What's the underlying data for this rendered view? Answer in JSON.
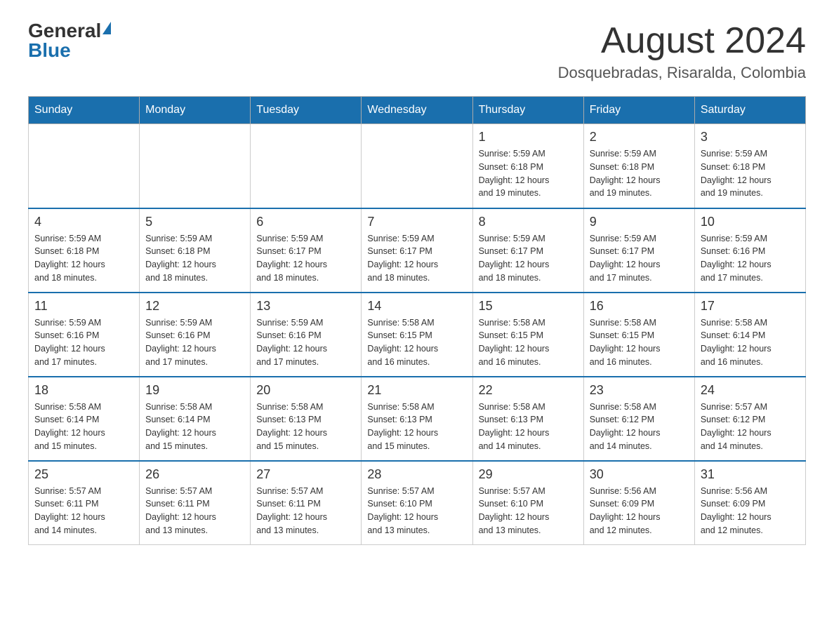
{
  "header": {
    "logo_general": "General",
    "logo_blue": "Blue",
    "month_title": "August 2024",
    "location": "Dosquebradas, Risaralda, Colombia"
  },
  "days_of_week": [
    "Sunday",
    "Monday",
    "Tuesday",
    "Wednesday",
    "Thursday",
    "Friday",
    "Saturday"
  ],
  "weeks": [
    {
      "days": [
        {
          "number": "",
          "info": ""
        },
        {
          "number": "",
          "info": ""
        },
        {
          "number": "",
          "info": ""
        },
        {
          "number": "",
          "info": ""
        },
        {
          "number": "1",
          "info": "Sunrise: 5:59 AM\nSunset: 6:18 PM\nDaylight: 12 hours\nand 19 minutes."
        },
        {
          "number": "2",
          "info": "Sunrise: 5:59 AM\nSunset: 6:18 PM\nDaylight: 12 hours\nand 19 minutes."
        },
        {
          "number": "3",
          "info": "Sunrise: 5:59 AM\nSunset: 6:18 PM\nDaylight: 12 hours\nand 19 minutes."
        }
      ]
    },
    {
      "days": [
        {
          "number": "4",
          "info": "Sunrise: 5:59 AM\nSunset: 6:18 PM\nDaylight: 12 hours\nand 18 minutes."
        },
        {
          "number": "5",
          "info": "Sunrise: 5:59 AM\nSunset: 6:18 PM\nDaylight: 12 hours\nand 18 minutes."
        },
        {
          "number": "6",
          "info": "Sunrise: 5:59 AM\nSunset: 6:17 PM\nDaylight: 12 hours\nand 18 minutes."
        },
        {
          "number": "7",
          "info": "Sunrise: 5:59 AM\nSunset: 6:17 PM\nDaylight: 12 hours\nand 18 minutes."
        },
        {
          "number": "8",
          "info": "Sunrise: 5:59 AM\nSunset: 6:17 PM\nDaylight: 12 hours\nand 18 minutes."
        },
        {
          "number": "9",
          "info": "Sunrise: 5:59 AM\nSunset: 6:17 PM\nDaylight: 12 hours\nand 17 minutes."
        },
        {
          "number": "10",
          "info": "Sunrise: 5:59 AM\nSunset: 6:16 PM\nDaylight: 12 hours\nand 17 minutes."
        }
      ]
    },
    {
      "days": [
        {
          "number": "11",
          "info": "Sunrise: 5:59 AM\nSunset: 6:16 PM\nDaylight: 12 hours\nand 17 minutes."
        },
        {
          "number": "12",
          "info": "Sunrise: 5:59 AM\nSunset: 6:16 PM\nDaylight: 12 hours\nand 17 minutes."
        },
        {
          "number": "13",
          "info": "Sunrise: 5:59 AM\nSunset: 6:16 PM\nDaylight: 12 hours\nand 17 minutes."
        },
        {
          "number": "14",
          "info": "Sunrise: 5:58 AM\nSunset: 6:15 PM\nDaylight: 12 hours\nand 16 minutes."
        },
        {
          "number": "15",
          "info": "Sunrise: 5:58 AM\nSunset: 6:15 PM\nDaylight: 12 hours\nand 16 minutes."
        },
        {
          "number": "16",
          "info": "Sunrise: 5:58 AM\nSunset: 6:15 PM\nDaylight: 12 hours\nand 16 minutes."
        },
        {
          "number": "17",
          "info": "Sunrise: 5:58 AM\nSunset: 6:14 PM\nDaylight: 12 hours\nand 16 minutes."
        }
      ]
    },
    {
      "days": [
        {
          "number": "18",
          "info": "Sunrise: 5:58 AM\nSunset: 6:14 PM\nDaylight: 12 hours\nand 15 minutes."
        },
        {
          "number": "19",
          "info": "Sunrise: 5:58 AM\nSunset: 6:14 PM\nDaylight: 12 hours\nand 15 minutes."
        },
        {
          "number": "20",
          "info": "Sunrise: 5:58 AM\nSunset: 6:13 PM\nDaylight: 12 hours\nand 15 minutes."
        },
        {
          "number": "21",
          "info": "Sunrise: 5:58 AM\nSunset: 6:13 PM\nDaylight: 12 hours\nand 15 minutes."
        },
        {
          "number": "22",
          "info": "Sunrise: 5:58 AM\nSunset: 6:13 PM\nDaylight: 12 hours\nand 14 minutes."
        },
        {
          "number": "23",
          "info": "Sunrise: 5:58 AM\nSunset: 6:12 PM\nDaylight: 12 hours\nand 14 minutes."
        },
        {
          "number": "24",
          "info": "Sunrise: 5:57 AM\nSunset: 6:12 PM\nDaylight: 12 hours\nand 14 minutes."
        }
      ]
    },
    {
      "days": [
        {
          "number": "25",
          "info": "Sunrise: 5:57 AM\nSunset: 6:11 PM\nDaylight: 12 hours\nand 14 minutes."
        },
        {
          "number": "26",
          "info": "Sunrise: 5:57 AM\nSunset: 6:11 PM\nDaylight: 12 hours\nand 13 minutes."
        },
        {
          "number": "27",
          "info": "Sunrise: 5:57 AM\nSunset: 6:11 PM\nDaylight: 12 hours\nand 13 minutes."
        },
        {
          "number": "28",
          "info": "Sunrise: 5:57 AM\nSunset: 6:10 PM\nDaylight: 12 hours\nand 13 minutes."
        },
        {
          "number": "29",
          "info": "Sunrise: 5:57 AM\nSunset: 6:10 PM\nDaylight: 12 hours\nand 13 minutes."
        },
        {
          "number": "30",
          "info": "Sunrise: 5:56 AM\nSunset: 6:09 PM\nDaylight: 12 hours\nand 12 minutes."
        },
        {
          "number": "31",
          "info": "Sunrise: 5:56 AM\nSunset: 6:09 PM\nDaylight: 12 hours\nand 12 minutes."
        }
      ]
    }
  ]
}
